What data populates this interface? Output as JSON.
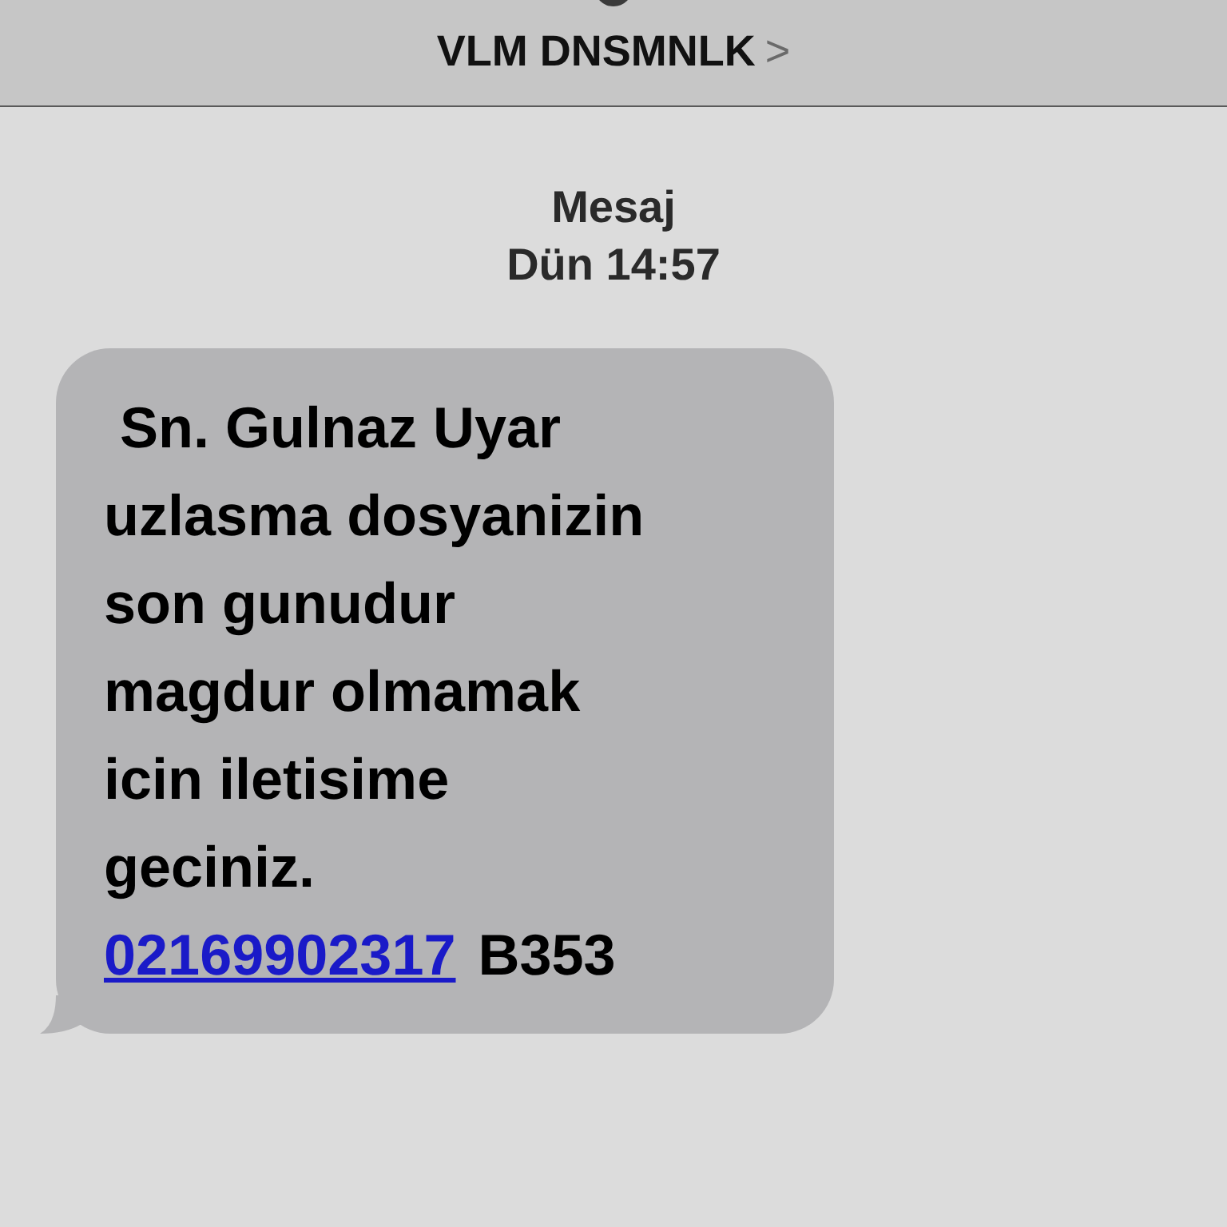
{
  "header": {
    "contact_name": "VLM DNSMNLK",
    "chevron": ">"
  },
  "conversation": {
    "service": "Mesaj",
    "timestamp": "Dün 14:57"
  },
  "message": {
    "lines": [
      " Sn. Gulnaz Uyar",
      "uzlasma dosyanizin",
      "son gunudur",
      "magdur olmamak",
      "icin iletisime",
      "geciniz."
    ],
    "phone_link": "02169902317",
    "code": "B353"
  }
}
